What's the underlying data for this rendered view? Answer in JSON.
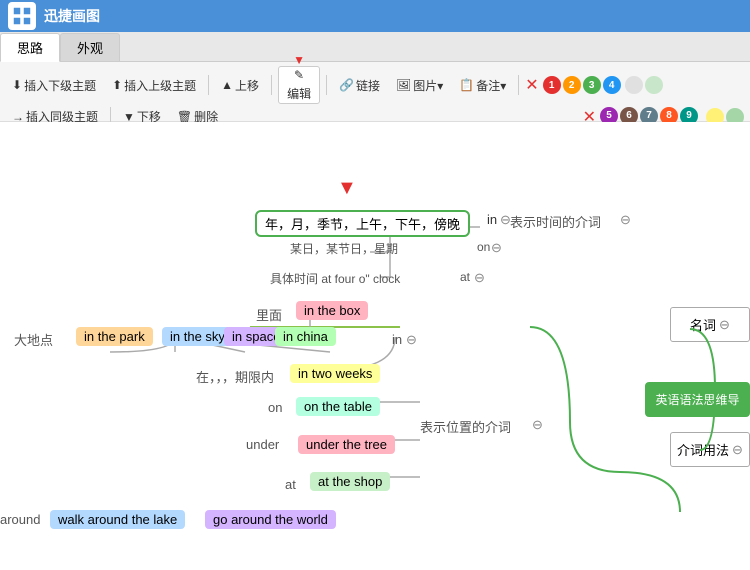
{
  "titleBar": {
    "iconText": "迅",
    "appName": "迅捷画图"
  },
  "tabs": [
    {
      "label": "思路",
      "active": true
    },
    {
      "label": "外观",
      "active": false
    }
  ],
  "toolbar": {
    "row1": [
      {
        "id": "insert-sub",
        "label": "插入下级主题",
        "icon": "↓"
      },
      {
        "id": "insert-super",
        "label": "插入上级主题",
        "icon": "↑"
      },
      {
        "id": "move-up",
        "label": "上移",
        "icon": "▲"
      },
      {
        "id": "edit",
        "label": "编辑",
        "icon": "✎",
        "highlighted": true
      },
      {
        "id": "link",
        "label": "链接",
        "icon": "🔗"
      },
      {
        "id": "image",
        "label": "图片▾",
        "icon": "🖼"
      },
      {
        "id": "note",
        "label": "备注▾",
        "icon": "📋"
      },
      {
        "id": "delete-x",
        "label": "",
        "icon": "✕",
        "color": "red"
      }
    ],
    "row2": [
      {
        "id": "insert-same",
        "label": "插入同级主题",
        "icon": "→"
      },
      {
        "id": "move-down",
        "label": "下移",
        "icon": "▼"
      },
      {
        "id": "delete",
        "label": "删除",
        "icon": "🗑"
      }
    ],
    "colorButtons": [
      "1",
      "2",
      "3",
      "4",
      "5",
      "6",
      "7",
      "8",
      "9"
    ],
    "colors": [
      "#e53030",
      "#ff9800",
      "#4caf50",
      "#2196f3",
      "#9c27b0",
      "#795548",
      "#607d8b",
      "#ff5722",
      "#009688"
    ]
  },
  "mindMap": {
    "mainNode": "年，月，季节，上午，下午，傍晚",
    "labels": {
      "in1": "in",
      "someDayLabel": "某日，某节日，星期",
      "on1": "on",
      "timeLabel": "表示时间的介词",
      "specificTimeLabel": "具体时间  at four o\" clock",
      "at1": "at",
      "limiLabel": "里面",
      "inTheBox": "in the box",
      "didiLabel": "大地点",
      "inThePark": "in the park",
      "inTheSky": "in the sky",
      "inSpace": "in space",
      "inChina": "in china",
      "in2": "in",
      "zaiLabel": "在，，，期限内",
      "inTwoWeeks": "in two weeks",
      "on2": "on",
      "onTheTable": "on the table",
      "under1": "under",
      "underTheTree": "under the tree",
      "biaoshiLabel": "表示位置的介词",
      "at2": "at",
      "atTheShop": "at the shop",
      "aroundLabel": "around",
      "walkAroundLabel": "walk around the lake",
      "goAroundLabel": "go around the world",
      "sidebarTitle1": "名词",
      "sidebarTitle2": "英语语法思维导",
      "sidebarTitle3": "介词用法"
    },
    "collapseCircles": [
      "⊖",
      "⊖",
      "⊖",
      "⊖",
      "⊖",
      "⊖"
    ]
  }
}
